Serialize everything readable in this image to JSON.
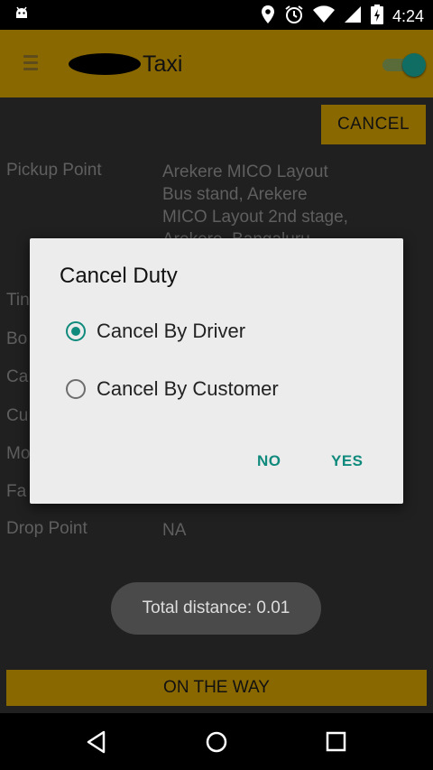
{
  "status_bar": {
    "time": "4:24",
    "icons": [
      "android-icon",
      "location-icon",
      "alarm-icon",
      "wifi-icon",
      "signal-icon",
      "battery-charging-icon"
    ]
  },
  "app_bar": {
    "title": "Taxi",
    "menu_icon": "hamburger-menu-icon",
    "toggle_state": "on"
  },
  "content": {
    "cancel_label": "CANCEL",
    "pickup": {
      "label": "Pickup Point",
      "lines": [
        "Arekere MICO Layout",
        "Bus stand, Arekere",
        "MICO Layout 2nd stage,",
        "Arekere, Bangaluru"
      ]
    },
    "partial_labels": [
      "Tin",
      "Bo",
      "Ca",
      "Cu",
      "Mo",
      "Fa"
    ],
    "drop": {
      "label": "Drop Point",
      "value": "NA"
    },
    "toast": "Total distance: 0.01",
    "on_the_way_label": "ON THE WAY"
  },
  "dialog": {
    "title": "Cancel Duty",
    "options": [
      {
        "label": "Cancel By Driver",
        "checked": true
      },
      {
        "label": "Cancel By Customer",
        "checked": false
      }
    ],
    "no_label": "NO",
    "yes_label": "YES"
  },
  "colors": {
    "accent": "#0f8a7c",
    "app_bar": "#8a6800",
    "background": "#202020"
  }
}
